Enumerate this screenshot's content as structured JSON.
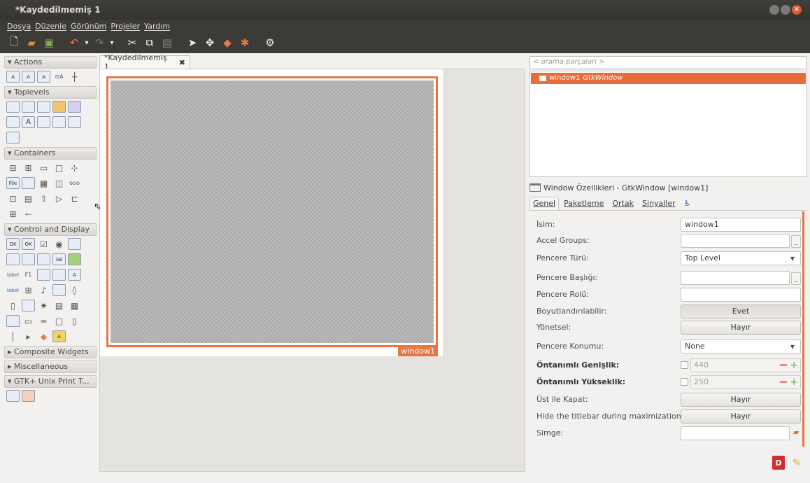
{
  "window": {
    "title": "*Kaydedilmemiş 1"
  },
  "menubar": [
    "Dosya",
    "Düzenle",
    "Görünüm",
    "Projeler",
    "Yardım"
  ],
  "toolbar": {
    "icons": [
      "new-icon",
      "open-icon",
      "save-icon",
      "undo-icon",
      "redo-icon",
      "cut-icon",
      "copy-icon",
      "paste-icon",
      "pointer-icon",
      "drag-resize-icon",
      "margin-edit-icon",
      "pin-icon",
      "alignment-edit-icon"
    ]
  },
  "palette": {
    "groups": [
      {
        "label": "Actions",
        "expanded": true,
        "rows": [
          [
            "A",
            "A",
            "A",
            "⊙A",
            "┼"
          ]
        ]
      },
      {
        "label": "Toplevels",
        "expanded": true,
        "rows": [
          [
            "",
            "",
            "",
            "",
            ""
          ],
          [
            "",
            "A",
            "",
            "",
            ""
          ],
          [
            ""
          ]
        ]
      },
      {
        "label": "Containers",
        "expanded": true,
        "rows": [
          [
            "",
            "",
            "",
            "",
            ""
          ],
          [
            "File",
            "",
            "",
            "",
            "ooo"
          ],
          [
            "",
            "",
            "",
            "▷",
            "▭"
          ],
          [
            "",
            ""
          ]
        ]
      },
      {
        "label": "Control and Display",
        "expanded": true,
        "rows": [
          [
            "OK",
            "OK",
            "☑",
            "◉",
            ""
          ],
          [
            "",
            "",
            "",
            "",
            ""
          ],
          [
            "label",
            "F1",
            "",
            "",
            ""
          ],
          [
            "label",
            "",
            "",
            "",
            ""
          ],
          [
            "",
            "",
            "",
            "",
            ""
          ],
          [
            "",
            "",
            "",
            ""
          ],
          [
            "",
            "",
            "",
            ""
          ]
        ]
      },
      {
        "label": "Composite Widgets",
        "expanded": false,
        "rows": []
      },
      {
        "label": "Miscellaneous",
        "expanded": false,
        "rows": []
      },
      {
        "label": "GTK+ Unix Print T...",
        "expanded": true,
        "rows": [
          [
            "",
            ""
          ]
        ]
      }
    ]
  },
  "document_tab": {
    "label": "*Kaydedilmemiş 1",
    "close": "✖"
  },
  "canvas": {
    "widget_label": "window1"
  },
  "inspector": {
    "search_placeholder": "< arama parçaları >",
    "tree_item_name": "window1",
    "tree_item_type": "GtkWindow"
  },
  "properties": {
    "header": "Window Özellikleri - GtkWindow [window1]",
    "tabs": [
      "Genel",
      "Paketleme",
      "Ortak",
      "Sinyaller"
    ],
    "rows": [
      {
        "label": "İsim:",
        "kind": "text",
        "value": "window1"
      },
      {
        "label": "Accel Groups:",
        "kind": "text-ellipsis",
        "value": ""
      },
      {
        "label": "Pencere Türü:",
        "kind": "combo",
        "value": "Top Level"
      },
      {
        "label": "Pencere Başlığı:",
        "kind": "text-ellipsis",
        "value": ""
      },
      {
        "label": "Pencere Rolü:",
        "kind": "text",
        "value": ""
      },
      {
        "label": "Boyutlandırılabilir:",
        "kind": "toggle",
        "value": "Evet"
      },
      {
        "label": "Yönetsel:",
        "kind": "toggle",
        "value": "Hayır"
      },
      {
        "label": "Pencere Konumu:",
        "kind": "combo",
        "value": "None"
      },
      {
        "label": "Öntanımlı Genişlik:",
        "kind": "spin",
        "value": "440",
        "bold": true
      },
      {
        "label": "Öntanımlı Yükseklik:",
        "kind": "spin",
        "value": "250",
        "bold": true
      },
      {
        "label": "Üst ile Kapat:",
        "kind": "toggle",
        "value": "Hayır"
      },
      {
        "label": "Hide the titlebar during maximization:",
        "kind": "toggle",
        "value": "Hayır"
      },
      {
        "label": "Simge:",
        "kind": "file",
        "value": ""
      }
    ]
  },
  "bottom": {
    "debug_label": "D",
    "clear_icon": "brush-icon"
  },
  "colors": {
    "accent": "#ea7543",
    "titlebar": "#3c3b37"
  }
}
